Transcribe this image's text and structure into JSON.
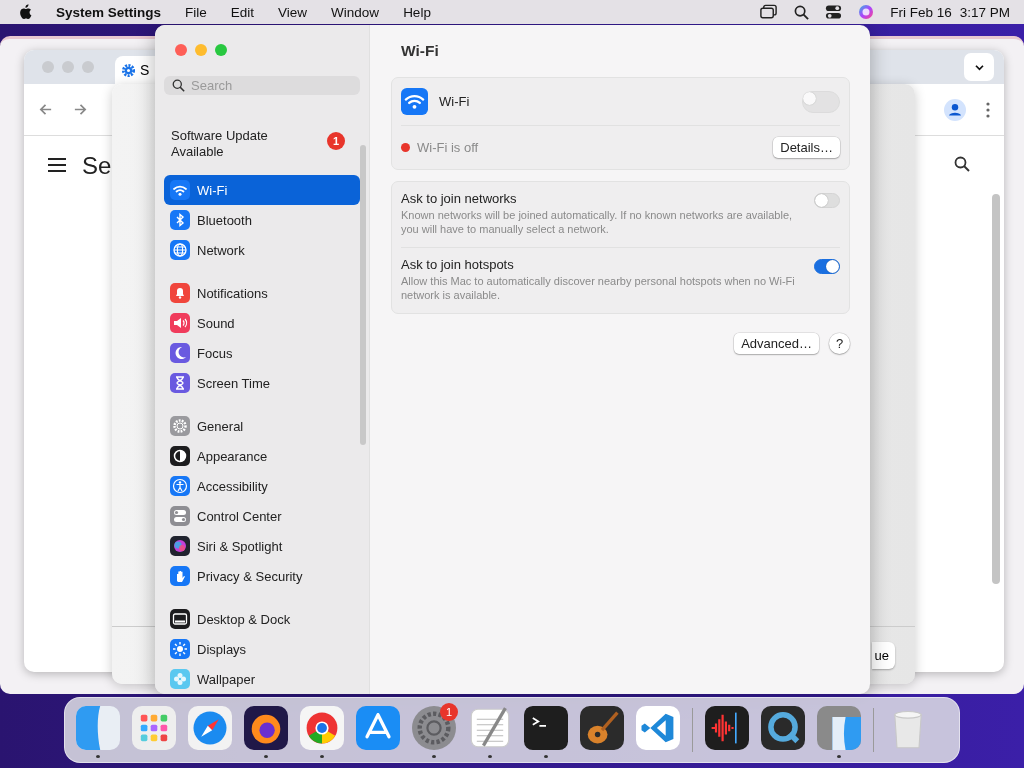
{
  "menu_bar": {
    "app_name": "System Settings",
    "menus": [
      "File",
      "Edit",
      "View",
      "Window",
      "Help"
    ],
    "date": "Fri Feb 16",
    "time": "3:17 PM"
  },
  "background_windows": {
    "browser": {
      "tab_label": "S",
      "heading": "Se"
    },
    "dialog": {
      "button_label": "ue"
    }
  },
  "settings": {
    "title": "Wi-Fi",
    "search": {
      "placeholder": "Search"
    },
    "update": {
      "label": "Software Update Available",
      "badge": "1"
    },
    "sidebar": {
      "groups": [
        {
          "items": [
            {
              "label": "Wi-Fi",
              "selected": true
            },
            {
              "label": "Bluetooth",
              "selected": false
            },
            {
              "label": "Network",
              "selected": false
            }
          ]
        },
        {
          "items": [
            {
              "label": "Notifications",
              "selected": false
            },
            {
              "label": "Sound",
              "selected": false
            },
            {
              "label": "Focus",
              "selected": false
            },
            {
              "label": "Screen Time",
              "selected": false
            }
          ]
        },
        {
          "items": [
            {
              "label": "General",
              "selected": false
            },
            {
              "label": "Appearance",
              "selected": false
            },
            {
              "label": "Accessibility",
              "selected": false
            },
            {
              "label": "Control Center",
              "selected": false
            },
            {
              "label": "Siri & Spotlight",
              "selected": false
            },
            {
              "label": "Privacy & Security",
              "selected": false
            }
          ]
        },
        {
          "items": [
            {
              "label": "Desktop & Dock",
              "selected": false
            },
            {
              "label": "Displays",
              "selected": false
            },
            {
              "label": "Wallpaper",
              "selected": false
            }
          ]
        }
      ]
    },
    "wifi": {
      "label": "Wi-Fi",
      "on": false,
      "status": "Wi-Fi is off",
      "details_button": "Details…"
    },
    "options": [
      {
        "title": "Ask to join networks",
        "description": "Known networks will be joined automatically. If no known networks are available, you will have to manually select a network.",
        "on": false
      },
      {
        "title": "Ask to join hotspots",
        "description": "Allow this Mac to automatically discover nearby personal hotspots when no Wi-Fi network is available.",
        "on": true
      }
    ],
    "buttons": {
      "advanced": "Advanced…",
      "help": "?"
    }
  },
  "dock": {
    "sections": [
      {
        "apps": [
          {
            "running": true
          },
          {
            "running": false
          },
          {
            "running": false
          },
          {
            "running": true
          },
          {
            "running": true
          },
          {
            "running": false
          },
          {
            "running": true,
            "badge": "1"
          },
          {
            "running": true
          },
          {
            "running": true
          },
          {
            "running": false
          },
          {
            "running": false
          }
        ]
      },
      {
        "apps": [
          {
            "running": false
          },
          {
            "running": false
          },
          {
            "running": true
          }
        ]
      },
      {
        "apps": [
          {
            "running": false
          }
        ]
      }
    ]
  }
}
